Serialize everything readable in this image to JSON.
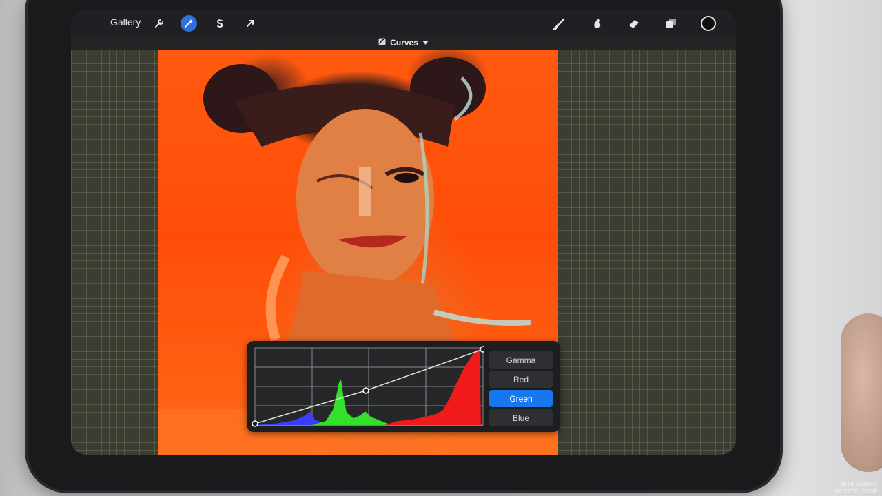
{
  "toolbar": {
    "gallery_label": "Gallery",
    "left_tools": [
      {
        "name": "actions",
        "icon": "wrench-icon"
      },
      {
        "name": "adjustments",
        "icon": "magic-wand-icon",
        "active": true
      },
      {
        "name": "selection",
        "icon": "selection-s-icon"
      },
      {
        "name": "transform",
        "icon": "arrow-cursor-icon"
      }
    ],
    "right_tools": [
      {
        "name": "brush",
        "icon": "brush-icon"
      },
      {
        "name": "smudge",
        "icon": "smudge-icon"
      },
      {
        "name": "eraser",
        "icon": "eraser-icon"
      },
      {
        "name": "layers",
        "icon": "layers-icon"
      },
      {
        "name": "color",
        "icon": "color-circle-icon",
        "color": "#101010"
      }
    ]
  },
  "adjustment": {
    "title": "Curves",
    "icon": "curves-icon"
  },
  "curves": {
    "channels": [
      {
        "label": "Gamma",
        "active": false
      },
      {
        "label": "Red",
        "active": false
      },
      {
        "label": "Green",
        "active": true
      },
      {
        "label": "Blue",
        "active": false
      }
    ],
    "accent_color": "#1677ee"
  },
  "watermark": {
    "line1": "NITIL KUMAR",
    "line2": "ARTISTIC ZONE"
  }
}
